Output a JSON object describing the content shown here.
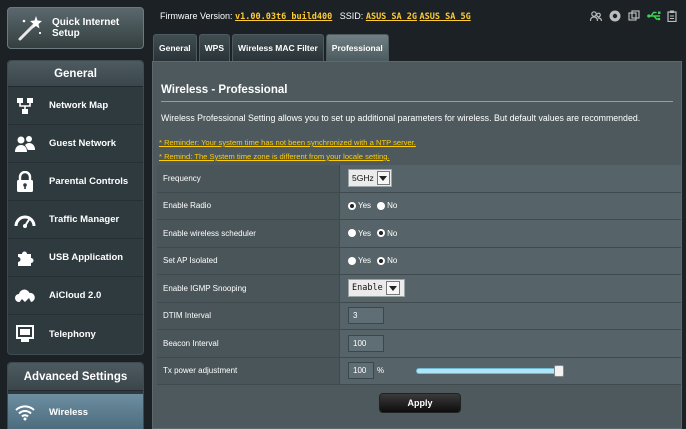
{
  "sidebar": {
    "quick_setup": {
      "label_line1": "Quick Internet",
      "label_line2": "Setup",
      "icon": "wand-icon"
    },
    "general": {
      "header": "General",
      "items": [
        {
          "label": "Network Map",
          "icon": "network-map-icon"
        },
        {
          "label": "Guest Network",
          "icon": "guest-network-icon"
        },
        {
          "label": "Parental Controls",
          "icon": "lock-icon"
        },
        {
          "label": "Traffic Manager",
          "icon": "gauge-icon"
        },
        {
          "label": "USB Application",
          "icon": "puzzle-icon"
        },
        {
          "label": "AiCloud 2.0",
          "icon": "cloud-icon"
        },
        {
          "label": "Telephony",
          "icon": "monitor-icon"
        }
      ]
    },
    "advanced": {
      "header": "Advanced Settings",
      "active_item": {
        "label": "Wireless",
        "icon": "wifi-icon"
      }
    }
  },
  "topbar": {
    "firmware_label": "Firmware Version:",
    "firmware_value": "v1.00.03t6_build400",
    "ssid_label": "SSID:",
    "ssid_2g": "ASUS_SA_2G",
    "ssid_5g": "ASUS_SA_5G",
    "status_icons": [
      "users-icon",
      "globe-icon",
      "printer-icon",
      "usb-icon",
      "clipboard-icon"
    ],
    "usb_color": "#39d353"
  },
  "tabs": [
    {
      "label": "General",
      "active": false
    },
    {
      "label": "WPS",
      "active": false
    },
    {
      "label": "Wireless MAC Filter",
      "active": false
    },
    {
      "label": "Professional",
      "active": true
    }
  ],
  "panel": {
    "title": "Wireless - Professional",
    "description": "Wireless Professional Setting allows you to set up additional parameters for wireless. But default values are recommended.",
    "reminder_1": "* Reminder: Your system time has not been synchronized with a NTP server.",
    "reminder_2": "* Remind: The System time zone is different from your locale setting.",
    "reminder_color": "#ffcc00",
    "rows": {
      "frequency": {
        "label": "Frequency",
        "value": "5GHz"
      },
      "enable_radio": {
        "label": "Enable Radio",
        "yes": "Yes",
        "no": "No",
        "selected": "Yes"
      },
      "scheduler": {
        "label": "Enable wireless scheduler",
        "yes": "Yes",
        "no": "No",
        "selected": "No"
      },
      "ap_isolated": {
        "label": "Set AP Isolated",
        "yes": "Yes",
        "no": "No",
        "selected": "No"
      },
      "igmp": {
        "label": "Enable IGMP Snooping",
        "value": "Enable"
      },
      "dtim": {
        "label": "DTIM Interval",
        "value": "3"
      },
      "beacon": {
        "label": "Beacon Interval",
        "value": "100"
      },
      "txpower": {
        "label": "Tx power adjustment",
        "value": "100",
        "unit": "%",
        "level_percent": 100
      }
    },
    "apply_label": "Apply"
  }
}
